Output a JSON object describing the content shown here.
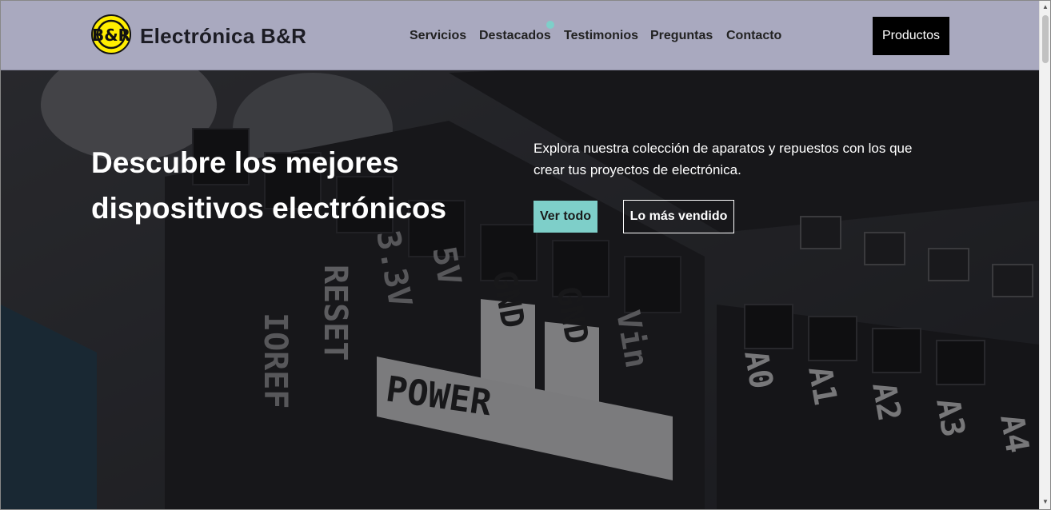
{
  "header": {
    "brand": "Electrónica B&R",
    "logo_text": "B&R",
    "nav": [
      "Servicios",
      "Destacados",
      "Testimonios",
      "Preguntas",
      "Contacto"
    ],
    "cta": "Productos"
  },
  "hero": {
    "title_line1": "Descubre los mejores",
    "title_line2": "dispositivos electrónicos",
    "description_line1": "Explora nuestra colección de aparatos y repuestos con los que",
    "description_line2": "crear tus proyectos de electrónica.",
    "btn_primary": "Ver todo",
    "btn_secondary": "Lo más vendido"
  },
  "board_labels": [
    "IOREF",
    "RESET",
    "3.3V",
    "5V",
    "GND",
    "GND",
    "Vin",
    "POWER",
    "A0",
    "A1",
    "A2",
    "A3",
    "A4"
  ],
  "colors": {
    "header_bg": "#a9a9bf",
    "accent": "#7ecfc9",
    "logo_yellow": "#ffee00",
    "cta_bg": "#000000"
  }
}
